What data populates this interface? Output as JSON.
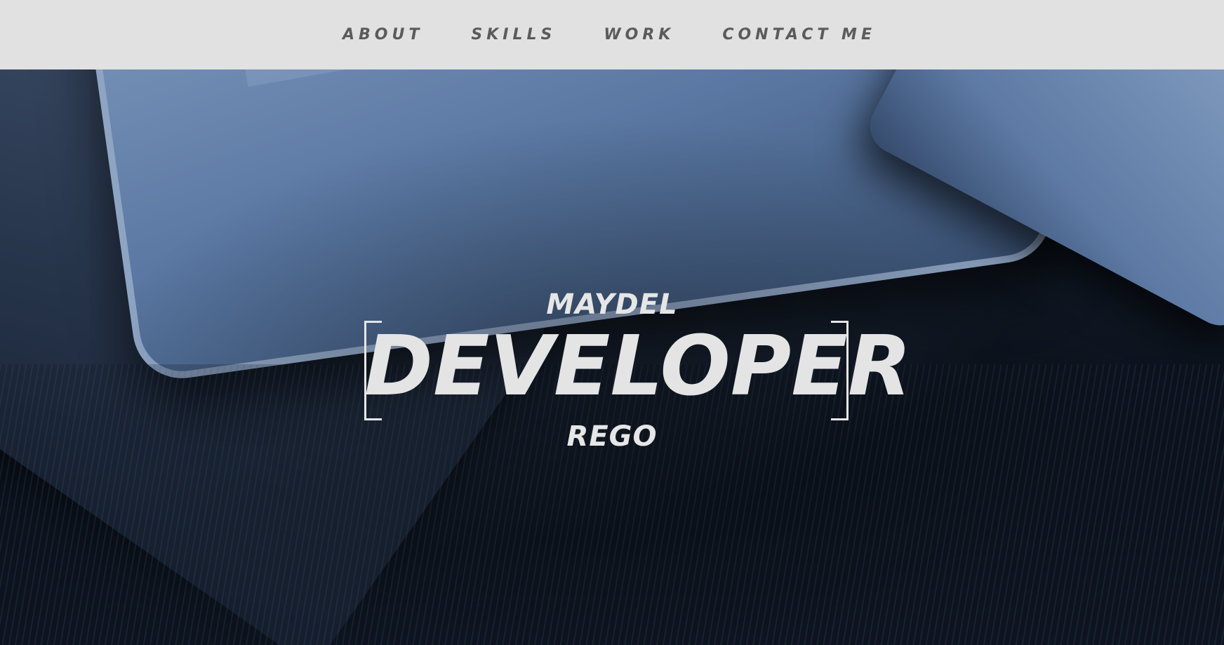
{
  "nav": {
    "items": [
      {
        "label": "ABOUT"
      },
      {
        "label": "SKILLS"
      },
      {
        "label": "WORK"
      },
      {
        "label": "CONTACT ME"
      }
    ]
  },
  "hero": {
    "first_name": "MAYDEL",
    "role": "DEVELOPER",
    "last_name": "REGO"
  },
  "colors": {
    "navbar_bg": "#e1e1e1",
    "nav_text": "#5b5b5b",
    "hero_text": "#e6e6e6"
  }
}
